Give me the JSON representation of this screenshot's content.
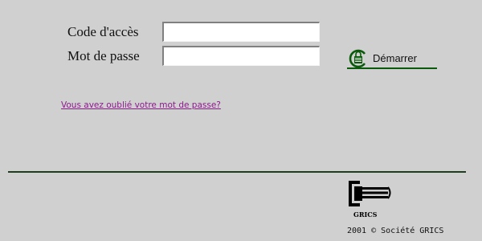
{
  "form": {
    "code_label": "Code d'accès",
    "code_value": "",
    "password_label": "Mot de passe",
    "password_value": ""
  },
  "start_button": {
    "label": "Démarrer",
    "icon": "padlock-icon"
  },
  "forgot_link": "Vous avez oublié votre mot de passe?",
  "footer": {
    "logo_text": "GRICS",
    "logo_icon": "grics-logo-icon",
    "copyright": "2001 © Société GRICS"
  },
  "colors": {
    "background": "#d0d0d0",
    "divider": "#1f3d1f",
    "link": "#8b1a8b",
    "button_accent": "#0b5a0b"
  }
}
